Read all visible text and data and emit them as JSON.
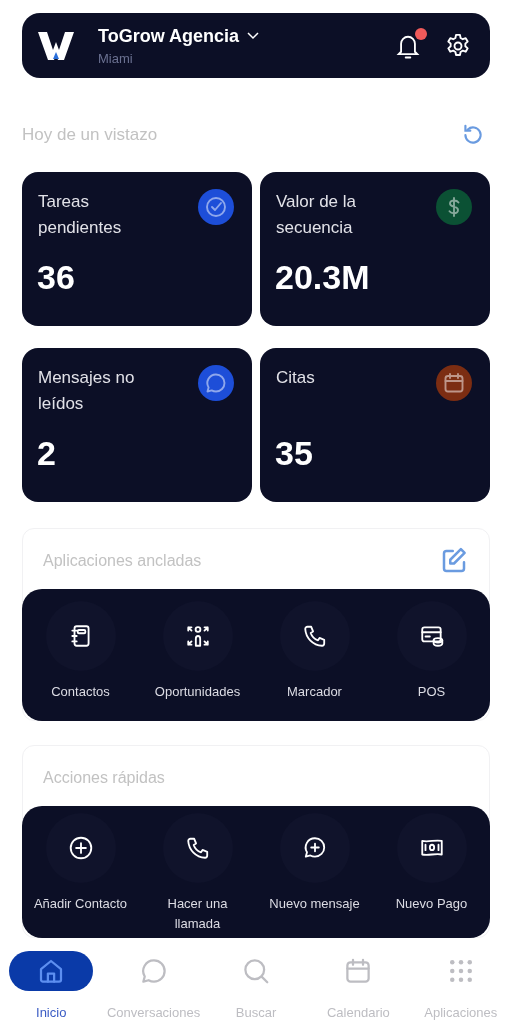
{
  "header": {
    "title": "ToGrow Agencia",
    "subtitle": "Miami",
    "notification_badge": true
  },
  "overview": {
    "title": "Hoy de un vistazo",
    "cards": [
      {
        "label": "Tareas pendientes",
        "value": "36",
        "kind": "check",
        "color": "#1d4ed8"
      },
      {
        "label": "Valor de la secuencia",
        "value": "20.3M",
        "kind": "dollar",
        "color": "#0b5134"
      },
      {
        "label": "Mensajes no leídos",
        "value": "2",
        "kind": "chat",
        "color": "#1d4ed8"
      },
      {
        "label": "Citas",
        "value": "35",
        "kind": "calendar",
        "color": "#7c2d12"
      }
    ]
  },
  "pinned_apps": {
    "title": "Aplicaciones ancladas",
    "items": [
      {
        "label": "Contactos",
        "kind": "notebook"
      },
      {
        "label": "Oportunidades",
        "kind": "people"
      },
      {
        "label": "Marcador",
        "kind": "phone"
      },
      {
        "label": "POS",
        "kind": "card"
      }
    ]
  },
  "quick_actions": {
    "title": "Acciones rápidas",
    "items": [
      {
        "label": "Añadir Contacto",
        "kind": "plus"
      },
      {
        "label": "Hacer una llamada",
        "kind": "phone"
      },
      {
        "label": "Nuevo mensaje",
        "kind": "chatplus"
      },
      {
        "label": "Nuevo Pago",
        "kind": "money"
      }
    ]
  },
  "bottom_nav": [
    {
      "label": "Inicio",
      "kind": "home",
      "selected": true
    },
    {
      "label": "Conversaciones",
      "kind": "chat",
      "selected": false
    },
    {
      "label": "Buscar",
      "kind": "search",
      "selected": false
    },
    {
      "label": "Calendario",
      "kind": "calendar",
      "selected": false
    },
    {
      "label": "Aplicaciones",
      "kind": "grid",
      "selected": false
    }
  ]
}
